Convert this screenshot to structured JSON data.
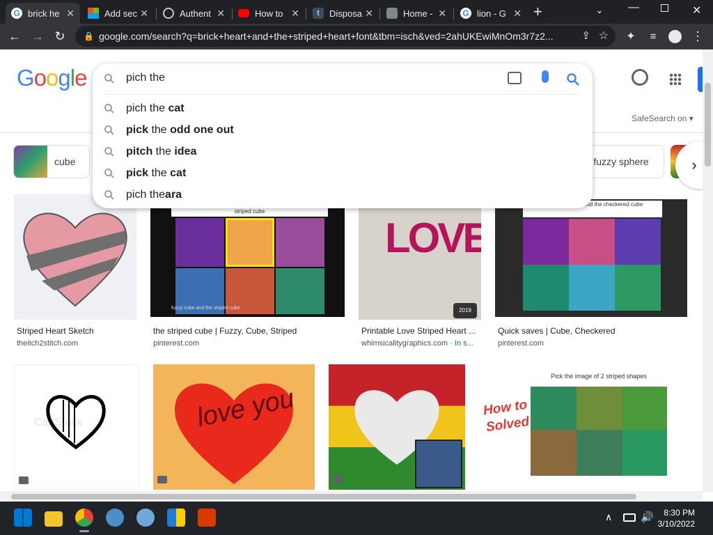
{
  "browser": {
    "tabs": [
      {
        "label": "brick he",
        "active": true,
        "favicon": "google-icon"
      },
      {
        "label": "Add sec",
        "favicon": "microsoft-icon"
      },
      {
        "label": "Authent",
        "favicon": "globe-icon"
      },
      {
        "label": "How to",
        "favicon": "youtube-icon"
      },
      {
        "label": "Disposa",
        "favicon": "tumblr-icon"
      },
      {
        "label": "Home -",
        "favicon": "site-icon"
      },
      {
        "label": "lion - G",
        "favicon": "google-icon"
      }
    ],
    "url": "google.com/search?q=brick+heart+and+the+striped+heart+font&tbm=isch&ved=2ahUKEwiMnOm3r7z2..."
  },
  "google": {
    "logo": "Google",
    "search_query": "pich the",
    "suggestions": [
      {
        "prefix": "pich the",
        "suffix": " cat",
        "prefix_bold": false
      },
      {
        "prefix": "pick",
        "suffix": " the",
        "tail": " odd one out",
        "prefix_bold": true
      },
      {
        "prefix": "pitch",
        "suffix": " the",
        "tail": " idea",
        "prefix_bold": true
      },
      {
        "prefix": "pick",
        "suffix": " the",
        "tail": " cat",
        "prefix_bold": true
      },
      {
        "prefix": "pich the",
        "suffix": "ara",
        "prefix_bold": false
      }
    ],
    "safesearch": "SafeSearch on",
    "chips": [
      "cube",
      "fuzzy sphere"
    ]
  },
  "results": [
    {
      "title": "Striped Heart Sketch",
      "source": "theitch2stitch.com"
    },
    {
      "title": "the striped cube | Fuzzy, Cube, Striped",
      "source": "pinterest.com"
    },
    {
      "title": "Printable Love Striped Heart ...",
      "source": "whimsicalitygraphics.com",
      "tag": " · In s..."
    },
    {
      "title": "Quick saves | Cube, Checkered",
      "source": "pinterest.com"
    }
  ],
  "image_text": {
    "striped_cube": "striped cube",
    "fuzzy_caption": "fuzzy cube and the striped cube",
    "quick_saves_header": "the striped cube and the checkered cube",
    "love_heart_text": "LOVE",
    "badge_2019": "2019",
    "how_to_solved": [
      "How to",
      "Solved"
    ],
    "two_striped_shapes": "Pick the image of 2 striped shapes",
    "love_you": "love you",
    "watermark": "CanStock"
  },
  "taskbar": {
    "time": "8:30 PM",
    "date": "3/10/2022"
  },
  "colors": {
    "tab_bar": "#202124",
    "toolbar": "#35363a",
    "google_blue": "#4285f4",
    "google_red": "#ea4335",
    "google_yellow": "#fbbc05",
    "google_green": "#34a853"
  }
}
